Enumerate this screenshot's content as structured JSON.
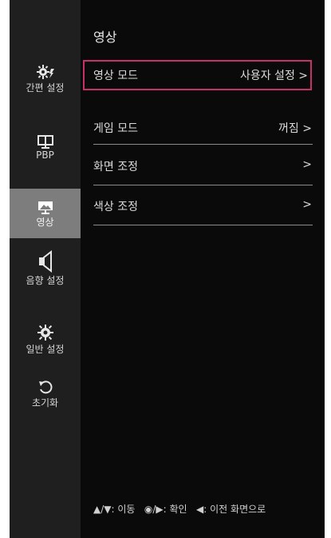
{
  "main": {
    "title": "영상",
    "rows": [
      {
        "label": "영상 모드",
        "value": "사용자 설정 >"
      },
      {
        "label": "게임 모드",
        "value": "꺼짐 >"
      },
      {
        "label": "화면 조정",
        "value": ">"
      },
      {
        "label": "색상 조정",
        "value": ">"
      }
    ]
  },
  "sidebar": {
    "items": [
      {
        "label": "간편 설정",
        "icon": "gear-quick-icon"
      },
      {
        "label": "PBP",
        "icon": "pbp-monitor-icon"
      },
      {
        "label": "영상",
        "icon": "picture-monitor-icon"
      },
      {
        "label": "음향 설정",
        "icon": "speaker-icon"
      },
      {
        "label": "일반 설정",
        "icon": "gear-icon"
      },
      {
        "label": "초기화",
        "icon": "reset-icon"
      }
    ]
  },
  "footer": {
    "move": "▲/▼: 이동",
    "confirm": "◉/▶: 확인",
    "back": "◀: 이전 화면으로"
  },
  "colors": {
    "background": "#0a0a0a",
    "sidebar": "#1f1f1f",
    "active_item": "#7d7d7d",
    "selection_border": "#c8306a"
  }
}
